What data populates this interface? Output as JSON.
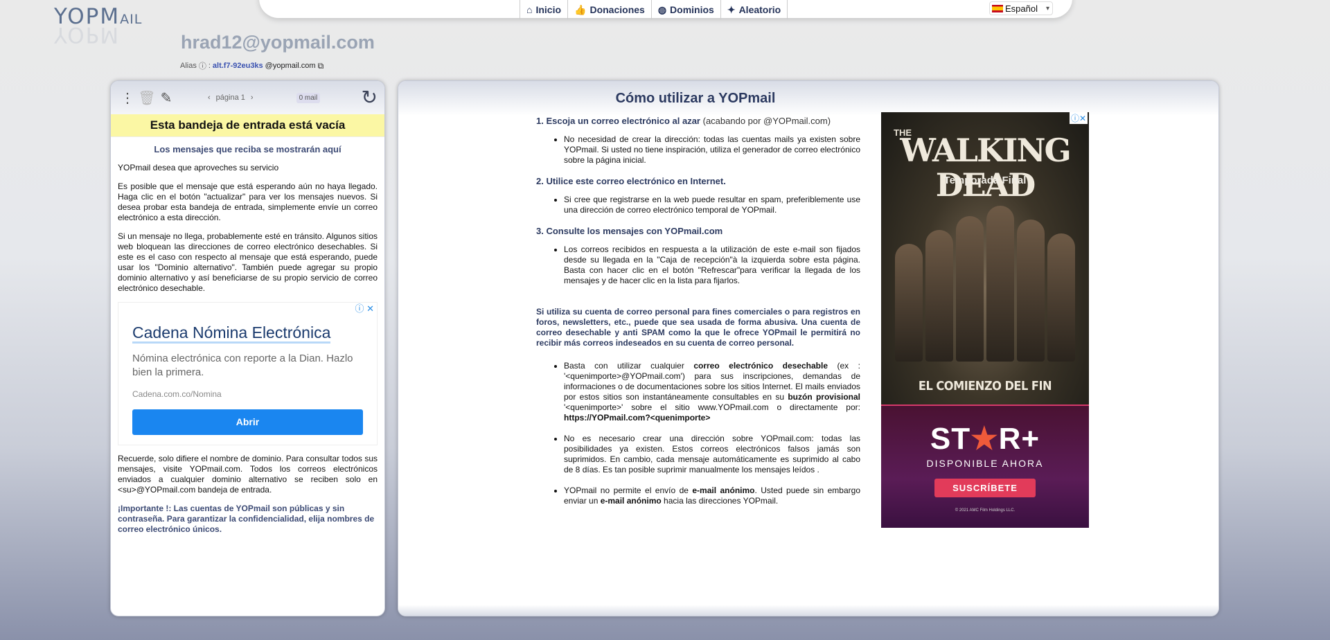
{
  "logo": {
    "text_main": "YOPM",
    "text_small": "AIL"
  },
  "nav": [
    {
      "label": "Inicio",
      "icon": "⌂"
    },
    {
      "label": "Donaciones",
      "icon": "👍"
    },
    {
      "label": "Dominios",
      "icon": "◍"
    },
    {
      "label": "Aleatorio",
      "icon": "✦"
    }
  ],
  "language": {
    "selected": "Español"
  },
  "mailbox": {
    "email": "hrad12@yopmail.com",
    "alias_label": "Alias",
    "alias_sep": ":",
    "alias_name": "alt.f7-92eu3ks",
    "alias_domain": "@yopmail.com"
  },
  "inbox": {
    "page_label": "página 1",
    "mail_count": "0 mail",
    "empty_banner": "Esta bandeja de entrada está vacía",
    "sub": "Los mensajes que reciba se mostrarán aquí",
    "p1": "YOPmail desea que aproveches su servicio",
    "p2": "Es posible que el mensaje que está esperando aún no haya llegado. Haga clic en el botón \"actualizar\" para ver los mensajes nuevos. Si desea probar esta bandeja de entrada, simplemente envíe un correo electrónico a esta dirección.",
    "p3": "Si un mensaje no llega, probablemente esté en tránsito. Algunos sitios web bloquean las direcciones de correo electrónico desechables. Si este es el caso con respecto al mensaje que está esperando, puede usar los \"Dominio alternativo\". También puede agregar su propio dominio alternativo y así beneficiarse de su propio servicio de correo electrónico desechable.",
    "p4": "Recuerde, solo difiere el nombre de dominio. Para consultar todos sus mensajes, visite YOPmail.com. Todos los correos electrónicos enviados a cualquier dominio alternativo se reciben solo en <su>@YOPmail.com bandeja de entrada.",
    "important": "¡Importante !: Las cuentas de YOPmail son públicas y sin contraseña. Para garantizar la confidencialidad, elija nombres de correo electrónico únicos."
  },
  "left_ad": {
    "title": "Cadena Nómina Electrónica",
    "desc": "Nómina electrónica con reporte a la Dian. Hazlo bien la primera.",
    "url": "Cadena.com.co/Nomina",
    "button": "Abrir"
  },
  "howto": {
    "title": "Cómo utilizar a YOPmail",
    "s1_title": "1. Escoja un correo electrónico al azar",
    "s1_plain": "(acabando por @YOPmail.com)",
    "s1_li": "No necesidad de crear la dirección: todas las cuentas mails ya existen sobre YOPmail. Si usted no tiene inspiración, utiliza el generador de correo electrónico sobre la página inicial.",
    "s2_title": "2. Utilice este correo electrónico en Internet.",
    "s2_li": "Si cree que registrarse en la web puede resultar en spam, preferiblemente use una dirección de correo electrónico temporal de YOPmail.",
    "s3_title": "3. Consulte los mensajes con YOPmail.com",
    "s3_li": "Los correos recibidos en respuesta a la utilización de este e-mail son fijados desde su llegada en la \"Caja de recepción\"à la izquierda sobre esta página. Basta con hacer clic en el botón \"Refrescar\"para verificar la llegada de los mensajes y de hacer clic en la lista para fijarlos.",
    "warn": "Si utiliza su cuenta de correo personal para fines comerciales o para registros en foros, newsletters, etc., puede que sea usada de forma abusiva. Una cuenta de correo desechable y anti SPAM como la que le ofrece YOPmail le permitirá no recibir más correos indeseados en su cuenta de correo personal.",
    "b1_a": "Basta con utilizar cualquier ",
    "b1_b": "correo electrónico desechable",
    "b1_c": " (ex : '<quenimporte>@YOPmail.com') para sus inscripciones, demandas de informaciones o de documentaciones sobre los sitios Internet. El mails enviados por estos sitios son instantáneamente consultables en su ",
    "b1_d": "buzón provisional",
    "b1_e": " '<quenimporte>' sobre el sitio www.YOPmail.com o directamente por: ",
    "b1_f": "https://YOPmail.com?<quenimporte>",
    "b2": "No es necesario crear una dirección sobre YOPmail.com: todas las posibilidades ya existen. Estos correos electrónicos falsos jamás son suprimidos. En cambio, cada mensaje automáticamente es suprimido al cabo de 8 días. Es tan posible suprimir manualmente los mensajes leídos .",
    "b3_a": "YOPmail no permite el envío de ",
    "b3_b": "e-mail anónimo",
    "b3_c": ". Usted puede sin embargo enviar un ",
    "b3_d": "e-mail anónimo",
    "b3_e": " hacia las direcciones YOPmail."
  },
  "right_ad": {
    "the": "THE",
    "title": "WALKING DEAD",
    "season": "Temporada Final",
    "tagline": "EL COMIENZO DEL FIN",
    "brand_a": "ST",
    "brand_star": "★",
    "brand_b": "R+",
    "available": "DISPONIBLE AHORA",
    "button": "SUSCRÍBETE",
    "copyright": "© 2021 AMC Film Holdings LLC."
  }
}
